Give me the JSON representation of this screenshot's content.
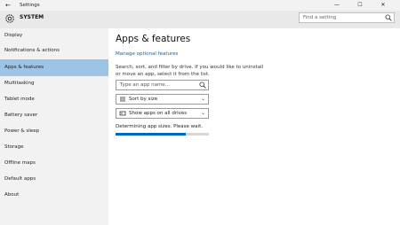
{
  "window": {
    "title": "Settings",
    "back_glyph": "←",
    "controls": {
      "minimize": "—",
      "maximize": "☐",
      "close": "✕"
    }
  },
  "header": {
    "title": "SYSTEM",
    "icon": "gear-icon",
    "search": {
      "placeholder": "Find a setting",
      "icon": "search-icon"
    }
  },
  "sidebar": {
    "items": [
      {
        "label": "Display"
      },
      {
        "label": "Notifications & actions"
      },
      {
        "label": "Apps & features",
        "selected": true
      },
      {
        "label": "Multitasking"
      },
      {
        "label": "Tablet mode"
      },
      {
        "label": "Battery saver"
      },
      {
        "label": "Power & sleep"
      },
      {
        "label": "Storage"
      },
      {
        "label": "Offline maps"
      },
      {
        "label": "Default apps"
      },
      {
        "label": "About"
      }
    ]
  },
  "main": {
    "title": "Apps & features",
    "optional_link": "Manage optional features",
    "description": "Search, sort, and filter by drive. If you would like to uninstall or move an app, select it from the list.",
    "search": {
      "placeholder": "Type an app name..."
    },
    "sort": {
      "value": "Sort by size"
    },
    "filter": {
      "value": "Show apps on all drives"
    },
    "status": "Determining app sizes. Please wait.",
    "progress": 0.75
  },
  "colors": {
    "accent": "#0067c0",
    "selection": "#9dc3e6",
    "sidebar": "#f2f2f2"
  }
}
